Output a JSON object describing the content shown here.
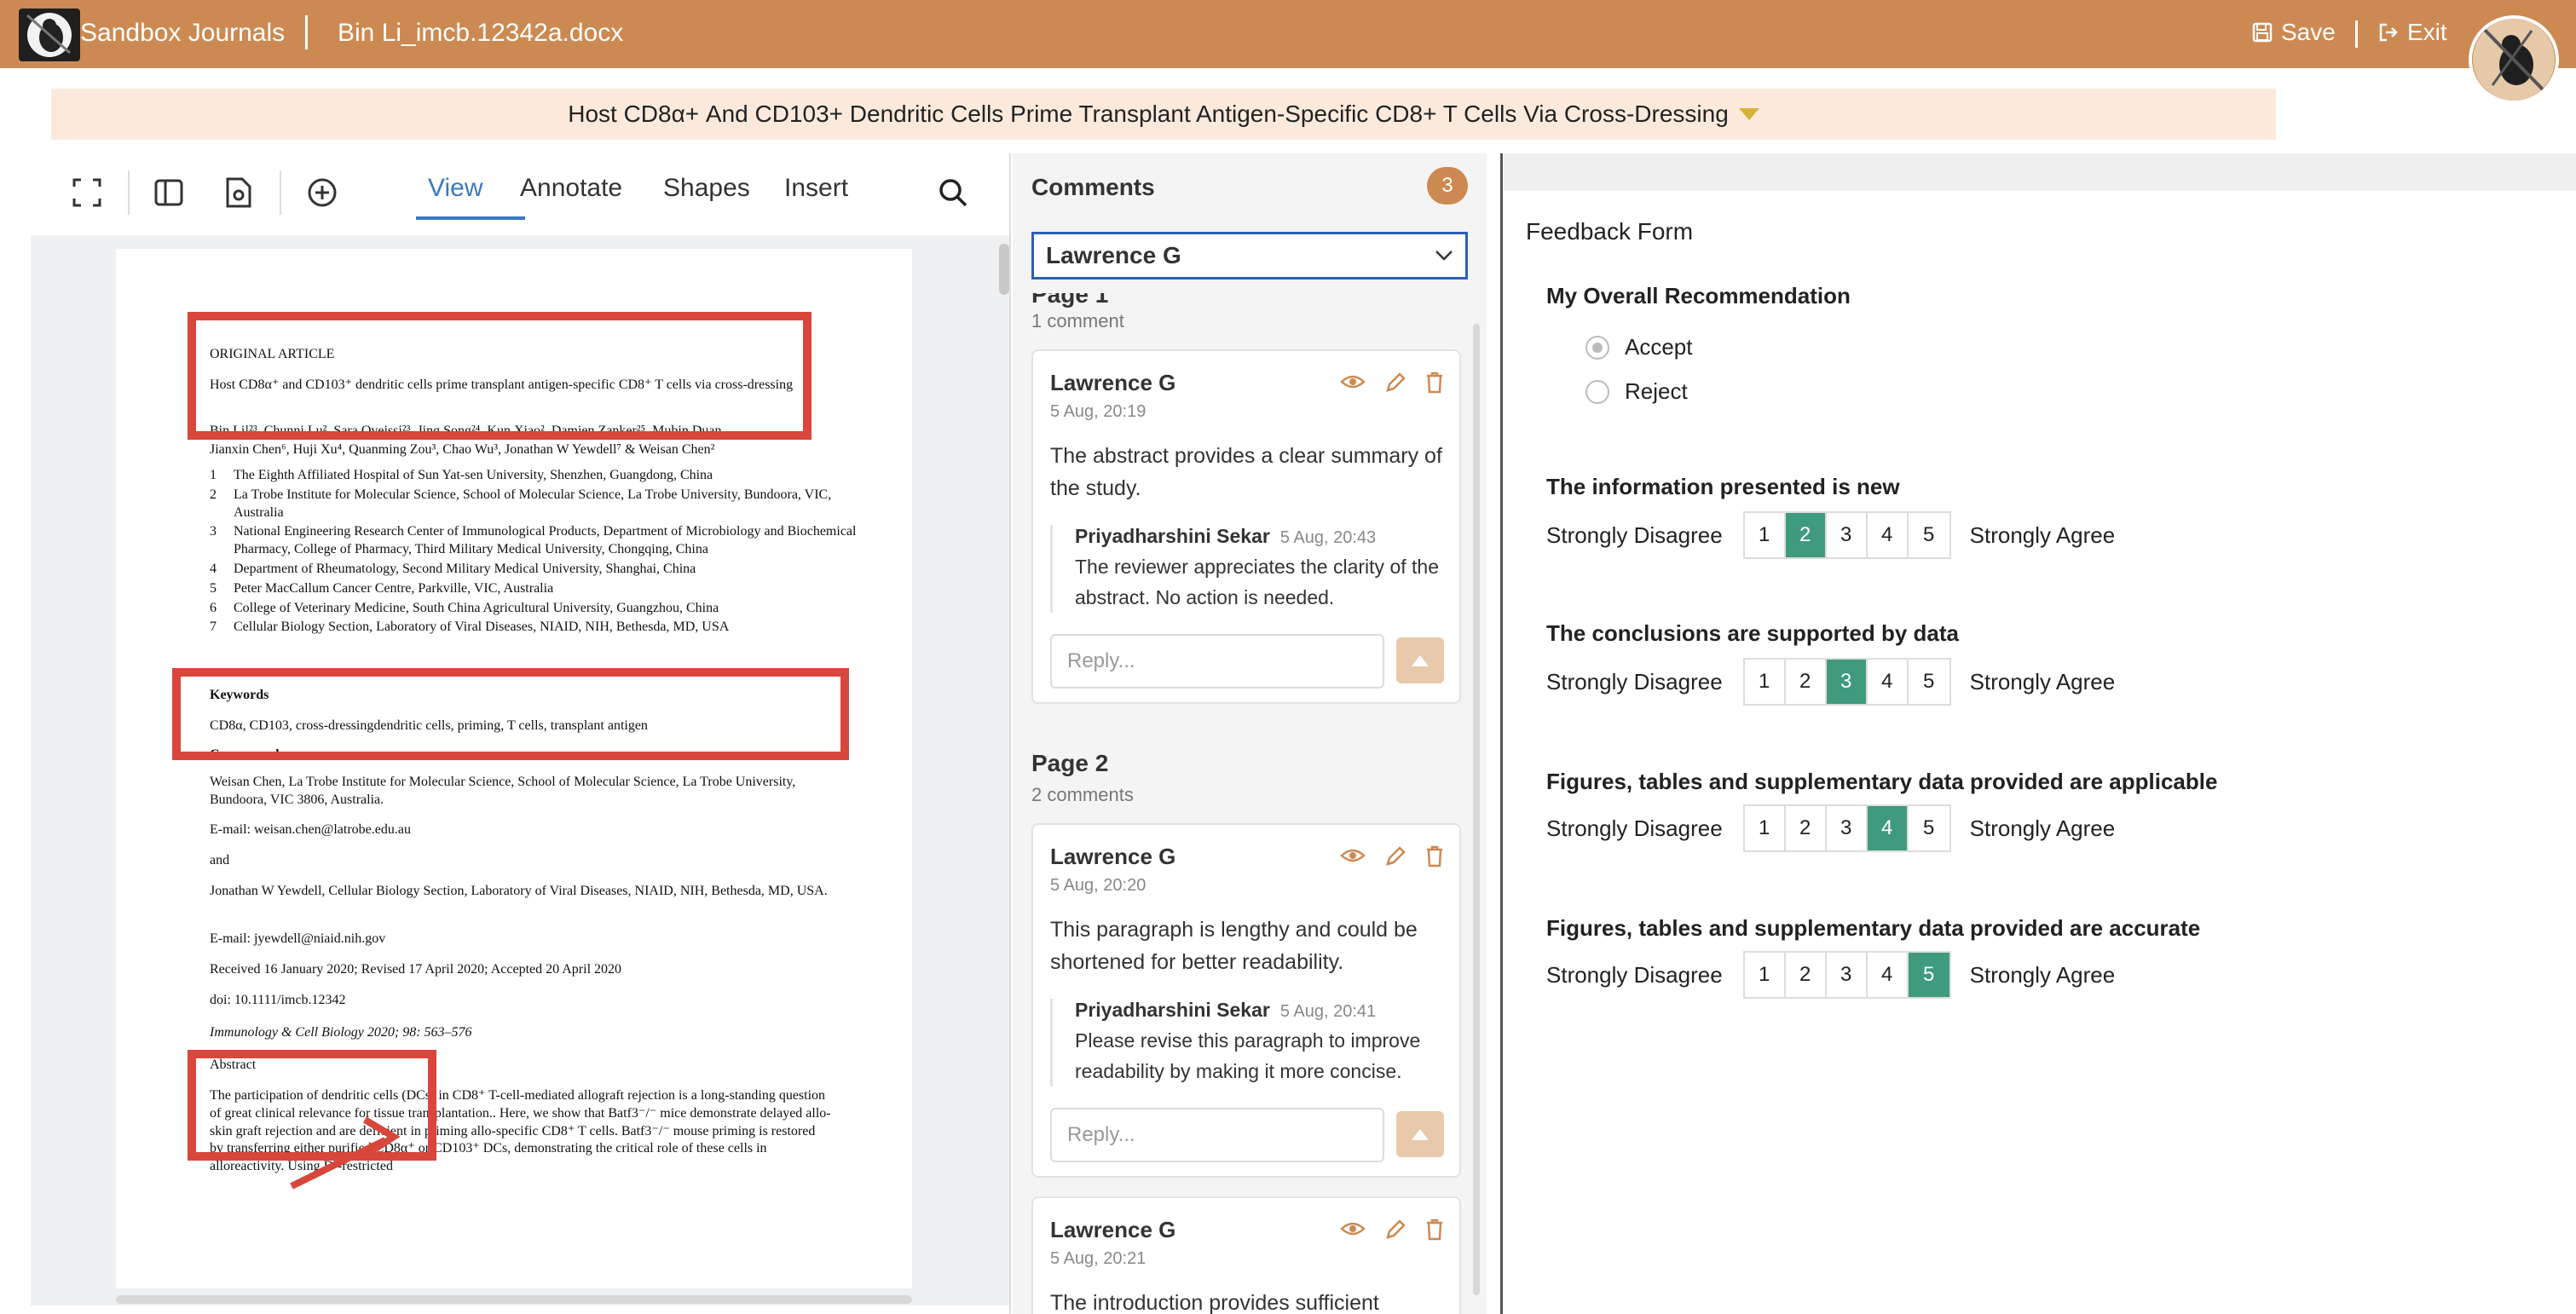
{
  "app": {
    "title": "Sandbox Journals",
    "doc_name": "Bin Li_imcb.12342a.docx",
    "save_label": "Save",
    "exit_label": "Exit"
  },
  "banner": {
    "title": "Host CD8α+ And CD103+ Dendritic Cells Prime Transplant Antigen-Specific CD8+ T Cells Via Cross-Dressing"
  },
  "viewer": {
    "tabs": [
      "View",
      "Annotate",
      "Shapes",
      "Insert"
    ],
    "active_tab": "View"
  },
  "document": {
    "heading": "ORIGINAL ARTICLE",
    "title": "Host CD8α⁺ and CD103⁺ dendritic cells prime transplant antigen-specific CD8⁺ T cells via cross-dressing",
    "authors_line1": "Bin Li¹²³, Chunni Lu², Sara Oveissi²³, Jing Song²⁴, Kun Xiao², Damien Zanker²⁵, Mubin Duan",
    "authors_line2": "Jianxin Chen⁶, Huji Xu⁴, Quanming Zou³, Chao Wu³, Jonathan W Yewdell⁷ & Weisan Chen²",
    "affiliations": [
      {
        "n": "1",
        "text": "The Eighth Affiliated Hospital of Sun Yat-sen University, Shenzhen, Guangdong, China"
      },
      {
        "n": "2",
        "text": "La Trobe Institute for Molecular Science, School of Molecular Science, La Trobe University, Bundoora, VIC, Australia"
      },
      {
        "n": "3",
        "text": "National Engineering Research Center of Immunological Products, Department of Microbiology and Biochemical Pharmacy, College of Pharmacy, Third Military Medical University, Chongqing, China"
      },
      {
        "n": "4",
        "text": "Department of Rheumatology, Second Military Medical University, Shanghai, China"
      },
      {
        "n": "5",
        "text": "Peter MacCallum Cancer Centre, Parkville, VIC, Australia"
      },
      {
        "n": "6",
        "text": "College of Veterinary Medicine, South China Agricultural University, Guangzhou, China"
      },
      {
        "n": "7",
        "text": "Cellular Biology Section, Laboratory of Viral Diseases, NIAID, NIH, Bethesda, MD, USA"
      }
    ],
    "keywords_heading": "Keywords",
    "keywords": "CD8α, CD103, cross-dressingdendritic cells, priming, T cells, transplant antigen",
    "correspondence_heading": "Correspondence",
    "corr1": "Weisan Chen, La Trobe Institute for Molecular Science, School of Molecular Science, La Trobe University, Bundoora, VIC 3806, Australia.",
    "email1": "E-mail: weisan.chen@latrobe.edu.au",
    "and": "and",
    "corr2": "Jonathan W Yewdell, Cellular Biology Section, Laboratory of Viral Diseases, NIAID, NIH, Bethesda, MD, USA.",
    "email2": "E-mail: jyewdell@niaid.nih.gov",
    "received": "Received 16 January 2020; Revised 17 April 2020; Accepted 20 April 2020",
    "doi": "doi: 10.1111/imcb.12342",
    "journal": "Immunology & Cell Biology 2020; 98: 563–576",
    "abstract_heading": "Abstract",
    "abstract": "The participation of dendritic cells (DCs) in CD8⁺ T-cell-mediated allograft rejection is a long-standing question of great clinical relevance for tissue transplantation.. Here, we show that Batf3⁻/⁻ mice demonstrate delayed allo-skin graft rejection and are deficient in priming allo-specific CD8⁺ T cells. Batf3⁻/⁻ mouse priming is restored by transferring either purified CD8α⁺ or CD103⁺ DCs, demonstrating the critical role of these cells in alloreactivity. Using Dᵇ-restricted"
  },
  "comments": {
    "header": "Comments",
    "count": "3",
    "reviewer": "Lawrence G",
    "reply_placeholder": "Reply...",
    "pages": [
      {
        "title": "Page 1",
        "count_label": "1 comment",
        "items": [
          {
            "author": "Lawrence G",
            "time": "5 Aug, 20:19",
            "text": "The abstract provides a clear summary of the study.",
            "reply": {
              "author": "Priyadharshini Sekar",
              "time": "5 Aug, 20:43",
              "text": "The reviewer appreciates the clarity of the abstract. No action is needed."
            }
          }
        ]
      },
      {
        "title": "Page 2",
        "count_label": "2 comments",
        "items": [
          {
            "author": "Lawrence G",
            "time": "5 Aug, 20:20",
            "text": "This paragraph is lengthy and could be shortened for better readability.",
            "reply": {
              "author": "Priyadharshini Sekar",
              "time": "5 Aug, 20:41",
              "text": "Please revise this paragraph to improve readability by making it more concise."
            }
          },
          {
            "author": "Lawrence G",
            "time": "5 Aug, 20:21",
            "text": "The introduction provides sufficient"
          }
        ]
      }
    ]
  },
  "feedback": {
    "title": "Feedback Form",
    "recommendation": {
      "question": "My Overall Recommendation",
      "options": [
        "Accept",
        "Reject"
      ],
      "selected": "Accept"
    },
    "scale_low": "Strongly Disagree",
    "scale_high": "Strongly Agree",
    "scale_values": [
      "1",
      "2",
      "3",
      "4",
      "5"
    ],
    "questions": [
      {
        "text": "The information presented is new",
        "selected": 2
      },
      {
        "text": "The conclusions are supported by data",
        "selected": 3
      },
      {
        "text": "Figures, tables and supplementary data provided are applicable",
        "selected": 4
      },
      {
        "text": "Figures, tables and supplementary data provided are accurate",
        "selected": 5
      }
    ]
  },
  "colors": {
    "brand": "#cc8a52",
    "accent_blue": "#3a78c4",
    "selected_green": "#3f9a7e",
    "annotation_red": "#d8463c"
  },
  "icons": [
    "fullscreen-icon",
    "sidebar-icon",
    "file-settings-icon",
    "add-circle-icon",
    "search-icon",
    "save-icon",
    "exit-icon",
    "eye-icon",
    "pencil-icon",
    "trash-icon",
    "send-arrow-icon",
    "chevron-down-icon"
  ]
}
